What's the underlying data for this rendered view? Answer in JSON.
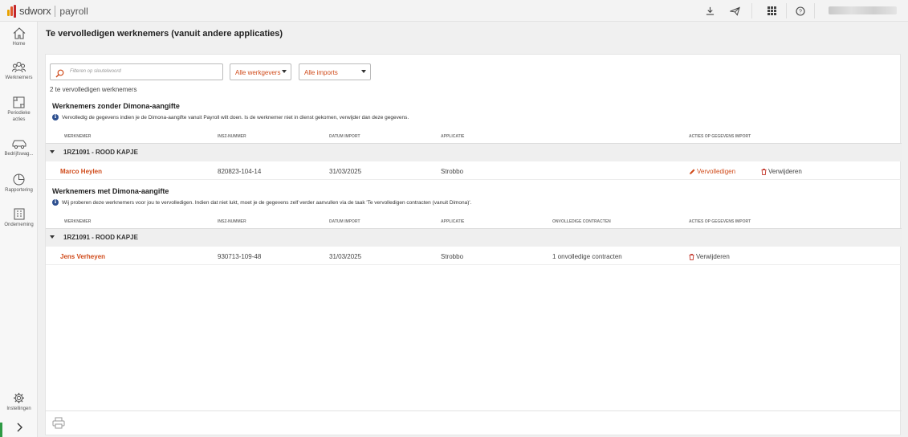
{
  "app": {
    "brand": "sdworx",
    "product": "payroll"
  },
  "topbar": {
    "icons": [
      "download-icon",
      "send-icon",
      "apps-grid-icon",
      "help-icon"
    ]
  },
  "sidebar": {
    "items": [
      {
        "label": "Home",
        "icon": "home-icon"
      },
      {
        "label": "Werknemers",
        "icon": "employees-icon"
      },
      {
        "label": "Periodieke\nacties",
        "icon": "periodic-actions-icon"
      },
      {
        "label": "Bedrijfswag...",
        "icon": "company-car-icon"
      },
      {
        "label": "Rapportering",
        "icon": "reporting-icon"
      },
      {
        "label": "Onderneming",
        "icon": "company-icon"
      },
      {
        "label": "Instellingen",
        "icon": "gear-icon"
      }
    ],
    "expand_icon": "chevron-right-icon"
  },
  "page": {
    "title": "Te vervolledigen werknemers (vanuit andere applicaties)"
  },
  "filters": {
    "search_placeholder": "Filteren op sleutelwoord",
    "employer_select": "Alle werkgevers",
    "imports_select": "Alle imports"
  },
  "count_text": "2 te vervolledigen werknemers",
  "sections": [
    {
      "title": "Werknemers zonder Dimona-aangifte",
      "info": "Vervolledig de gegevens indien je de Dimona-aangifte vanuit Payroll wilt doen. Is de werknemer niet in dienst gekomen, verwijder dan deze gegevens.",
      "columns": {
        "employee": "Werknemer",
        "insz": "INSZ-nummer",
        "date": "Datum import",
        "app": "Applicatie",
        "actions": "Acties op gegevens import"
      },
      "group": "1RZ1091 - ROOD KAPJE",
      "row": {
        "name": "Marco Heylen",
        "insz": "820823-104-14",
        "date": "31/03/2025",
        "app": "Strobbo",
        "edit_label": "Vervolledigen",
        "delete_label": "Verwijderen"
      }
    },
    {
      "title": "Werknemers met Dimona-aangifte",
      "info": "Wij proberen deze werknemers voor jou te vervolledigen. Indien dat niet lukt, moet je de gegevens zelf verder aanvullen via de taak 'Te vervolledigen contracten (vanuit Dimona)'.",
      "columns": {
        "employee": "Werknemer",
        "insz": "INSZ-nummer",
        "date": "Datum import",
        "app": "Applicatie",
        "incomplete": "Onvolledige contracten",
        "actions": "Acties op gegevens import"
      },
      "group": "1RZ1091 - ROOD KAPJE",
      "row": {
        "name": "Jens Verheyen",
        "insz": "930713-109-48",
        "date": "31/03/2025",
        "app": "Strobbo",
        "incomplete": "1 onvolledige contracten",
        "delete_label": "Verwijderen"
      }
    }
  ],
  "colors": {
    "accent": "#d04b1b",
    "info": "#2d4f8f",
    "active_indicator": "#2e9a44"
  }
}
